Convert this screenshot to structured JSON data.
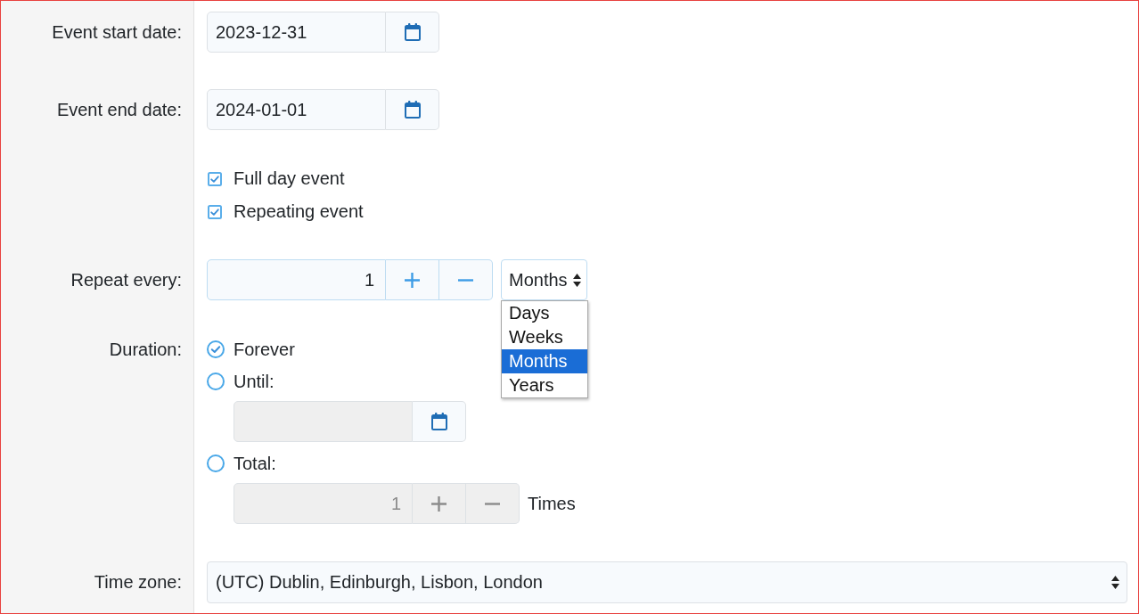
{
  "fields": [
    {
      "kind": "date",
      "label": "Event start date:",
      "value": "2023-12-31"
    },
    {
      "kind": "date",
      "label": "Event end date:",
      "value": "2024-01-01"
    },
    {
      "kind": "checks",
      "options": [
        {
          "label": "Full day event",
          "checked": true
        },
        {
          "label": "Repeating event",
          "checked": true
        }
      ]
    },
    {
      "kind": "repeat",
      "label": "Repeat every:",
      "value": "1",
      "unit": {
        "value": "Months",
        "expanded": true,
        "options": [
          {
            "label": "Days",
            "selected": false
          },
          {
            "label": "Weeks",
            "selected": false
          },
          {
            "label": "Months",
            "selected": true
          },
          {
            "label": "Years",
            "selected": false
          }
        ]
      }
    },
    {
      "kind": "duration",
      "label": "Duration:",
      "options": [
        {
          "kind": "plain",
          "label": "Forever",
          "selected": true
        },
        {
          "kind": "date",
          "label": "Until:",
          "selected": false,
          "disabled": true
        },
        {
          "kind": "count",
          "label": "Total:",
          "selected": false,
          "disabled": true,
          "value": "1",
          "suffix": "Times"
        }
      ]
    },
    {
      "kind": "select",
      "label": "Time zone:",
      "value": "(UTC) Dublin, Edinburgh, Lisbon, London"
    }
  ]
}
